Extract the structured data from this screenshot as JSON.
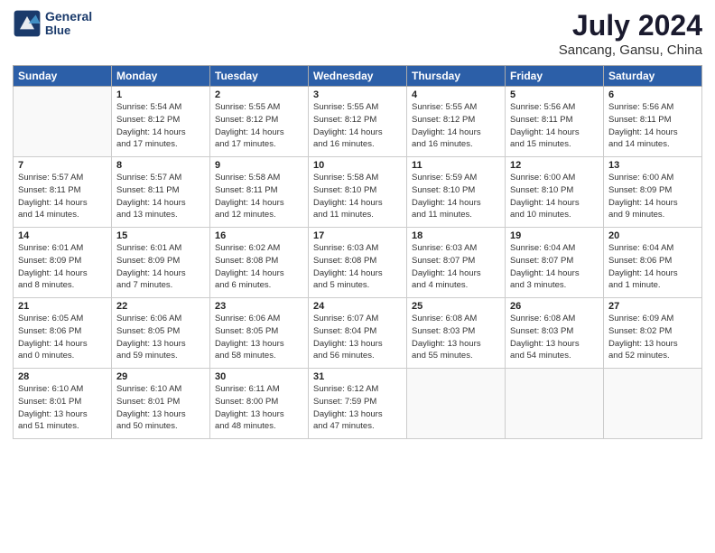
{
  "header": {
    "logo_line1": "General",
    "logo_line2": "Blue",
    "title": "July 2024",
    "subtitle": "Sancang, Gansu, China"
  },
  "columns": [
    "Sunday",
    "Monday",
    "Tuesday",
    "Wednesday",
    "Thursday",
    "Friday",
    "Saturday"
  ],
  "weeks": [
    [
      {
        "day": "",
        "info": ""
      },
      {
        "day": "1",
        "info": "Sunrise: 5:54 AM\nSunset: 8:12 PM\nDaylight: 14 hours\nand 17 minutes."
      },
      {
        "day": "2",
        "info": "Sunrise: 5:55 AM\nSunset: 8:12 PM\nDaylight: 14 hours\nand 17 minutes."
      },
      {
        "day": "3",
        "info": "Sunrise: 5:55 AM\nSunset: 8:12 PM\nDaylight: 14 hours\nand 16 minutes."
      },
      {
        "day": "4",
        "info": "Sunrise: 5:55 AM\nSunset: 8:12 PM\nDaylight: 14 hours\nand 16 minutes."
      },
      {
        "day": "5",
        "info": "Sunrise: 5:56 AM\nSunset: 8:11 PM\nDaylight: 14 hours\nand 15 minutes."
      },
      {
        "day": "6",
        "info": "Sunrise: 5:56 AM\nSunset: 8:11 PM\nDaylight: 14 hours\nand 14 minutes."
      }
    ],
    [
      {
        "day": "7",
        "info": "Sunrise: 5:57 AM\nSunset: 8:11 PM\nDaylight: 14 hours\nand 14 minutes."
      },
      {
        "day": "8",
        "info": "Sunrise: 5:57 AM\nSunset: 8:11 PM\nDaylight: 14 hours\nand 13 minutes."
      },
      {
        "day": "9",
        "info": "Sunrise: 5:58 AM\nSunset: 8:11 PM\nDaylight: 14 hours\nand 12 minutes."
      },
      {
        "day": "10",
        "info": "Sunrise: 5:58 AM\nSunset: 8:10 PM\nDaylight: 14 hours\nand 11 minutes."
      },
      {
        "day": "11",
        "info": "Sunrise: 5:59 AM\nSunset: 8:10 PM\nDaylight: 14 hours\nand 11 minutes."
      },
      {
        "day": "12",
        "info": "Sunrise: 6:00 AM\nSunset: 8:10 PM\nDaylight: 14 hours\nand 10 minutes."
      },
      {
        "day": "13",
        "info": "Sunrise: 6:00 AM\nSunset: 8:09 PM\nDaylight: 14 hours\nand 9 minutes."
      }
    ],
    [
      {
        "day": "14",
        "info": "Sunrise: 6:01 AM\nSunset: 8:09 PM\nDaylight: 14 hours\nand 8 minutes."
      },
      {
        "day": "15",
        "info": "Sunrise: 6:01 AM\nSunset: 8:09 PM\nDaylight: 14 hours\nand 7 minutes."
      },
      {
        "day": "16",
        "info": "Sunrise: 6:02 AM\nSunset: 8:08 PM\nDaylight: 14 hours\nand 6 minutes."
      },
      {
        "day": "17",
        "info": "Sunrise: 6:03 AM\nSunset: 8:08 PM\nDaylight: 14 hours\nand 5 minutes."
      },
      {
        "day": "18",
        "info": "Sunrise: 6:03 AM\nSunset: 8:07 PM\nDaylight: 14 hours\nand 4 minutes."
      },
      {
        "day": "19",
        "info": "Sunrise: 6:04 AM\nSunset: 8:07 PM\nDaylight: 14 hours\nand 3 minutes."
      },
      {
        "day": "20",
        "info": "Sunrise: 6:04 AM\nSunset: 8:06 PM\nDaylight: 14 hours\nand 1 minute."
      }
    ],
    [
      {
        "day": "21",
        "info": "Sunrise: 6:05 AM\nSunset: 8:06 PM\nDaylight: 14 hours\nand 0 minutes."
      },
      {
        "day": "22",
        "info": "Sunrise: 6:06 AM\nSunset: 8:05 PM\nDaylight: 13 hours\nand 59 minutes."
      },
      {
        "day": "23",
        "info": "Sunrise: 6:06 AM\nSunset: 8:05 PM\nDaylight: 13 hours\nand 58 minutes."
      },
      {
        "day": "24",
        "info": "Sunrise: 6:07 AM\nSunset: 8:04 PM\nDaylight: 13 hours\nand 56 minutes."
      },
      {
        "day": "25",
        "info": "Sunrise: 6:08 AM\nSunset: 8:03 PM\nDaylight: 13 hours\nand 55 minutes."
      },
      {
        "day": "26",
        "info": "Sunrise: 6:08 AM\nSunset: 8:03 PM\nDaylight: 13 hours\nand 54 minutes."
      },
      {
        "day": "27",
        "info": "Sunrise: 6:09 AM\nSunset: 8:02 PM\nDaylight: 13 hours\nand 52 minutes."
      }
    ],
    [
      {
        "day": "28",
        "info": "Sunrise: 6:10 AM\nSunset: 8:01 PM\nDaylight: 13 hours\nand 51 minutes."
      },
      {
        "day": "29",
        "info": "Sunrise: 6:10 AM\nSunset: 8:01 PM\nDaylight: 13 hours\nand 50 minutes."
      },
      {
        "day": "30",
        "info": "Sunrise: 6:11 AM\nSunset: 8:00 PM\nDaylight: 13 hours\nand 48 minutes."
      },
      {
        "day": "31",
        "info": "Sunrise: 6:12 AM\nSunset: 7:59 PM\nDaylight: 13 hours\nand 47 minutes."
      },
      {
        "day": "",
        "info": ""
      },
      {
        "day": "",
        "info": ""
      },
      {
        "day": "",
        "info": ""
      }
    ]
  ]
}
